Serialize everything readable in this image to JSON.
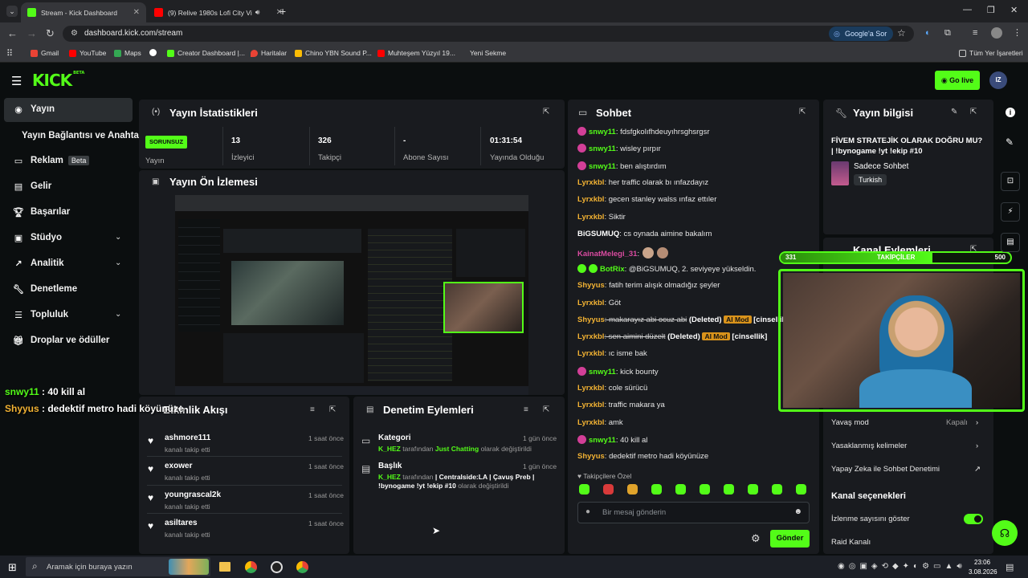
{
  "browser": {
    "tabs": [
      {
        "title": "Stream - Kick Dashboard",
        "active": true,
        "icon": "kick-icon"
      },
      {
        "title": "(9) Relive 1980s Lofi City Vi",
        "active": false,
        "icon": "youtube-icon"
      }
    ],
    "url": "dashboard.kick.com/stream",
    "google_sor": "Google'a Sor",
    "bookmarks": [
      "Gmail",
      "YouTube",
      "Maps",
      "Creator Dashboard |...",
      "Haritalar",
      "Chino YBN Sound P...",
      "Muhteşem Yüzyıl 19...",
      "Yeni Sekme"
    ],
    "all_bookmarks": "Tüm Yer İşaretleri"
  },
  "header": {
    "logo": "KICK",
    "logo_tag": "BETA",
    "go_live": "Go live",
    "avatar": "IZ"
  },
  "sidebar": {
    "items": [
      {
        "label": "Yayın",
        "icon": "broadcast-icon"
      },
      {
        "label": "Yayın Bağlantısı ve Anahtarı",
        "icon": ""
      },
      {
        "label": "Reklam",
        "badge": "Beta",
        "icon": "monitor-icon"
      },
      {
        "label": "Gelir",
        "icon": "revenue-icon"
      },
      {
        "label": "Başarılar",
        "icon": "trophy-icon"
      },
      {
        "label": "Stüdyo",
        "icon": "studio-icon"
      },
      {
        "label": "Analitik",
        "icon": "analytics-icon"
      },
      {
        "label": "Denetleme",
        "icon": "wrench-icon"
      },
      {
        "label": "Topluluk",
        "icon": "community-icon"
      },
      {
        "label": "Droplar ve ödüller",
        "icon": "gift-icon"
      }
    ]
  },
  "overlay_chat": [
    {
      "user": "snwy11",
      "text": " : 40 kill al",
      "color": "#53fc18"
    },
    {
      "user": "Shyyus",
      "text": " : dedektif metro hadi köyünüze",
      "color": "#f2b233"
    }
  ],
  "stats": {
    "title": "Yayın İstatistikleri",
    "status": "SORUNSUZ",
    "status_label": "Yayın",
    "items": [
      {
        "value": "13",
        "label": "İzleyici"
      },
      {
        "value": "326",
        "label": "Takipçi"
      },
      {
        "value": "-",
        "label": "Abone Sayısı"
      },
      {
        "value": "01:31:54",
        "label": "Yayında Olduğu"
      }
    ]
  },
  "preview": {
    "title": "Yayın Ön İzlemesi"
  },
  "activity": {
    "title": "Etkinlik Akışı",
    "items": [
      {
        "name": "ashmore111",
        "sub": "kanalı takip etti",
        "time": "1 saat önce"
      },
      {
        "name": "exower",
        "sub": "kanalı takip etti",
        "time": "1 saat önce"
      },
      {
        "name": "youngrascal2k",
        "sub": "kanalı takip etti",
        "time": "1 saat önce"
      },
      {
        "name": "asiltares",
        "sub": "kanalı takip etti",
        "time": "1 saat önce"
      }
    ]
  },
  "moderation": {
    "title": "Denetim Eylemleri",
    "items": [
      {
        "name": "Kategori",
        "who": "K_HEZ",
        "mid": " tarafından ",
        "value": "Just Chatting",
        "end": " olarak değiştirildi",
        "time": "1 gün önce"
      },
      {
        "name": "Başlık",
        "who": "K_HEZ",
        "mid": " tarafından ",
        "value": "| Centralside:LA | Çavuş Preb | !bynogame !yt !ekip #10",
        "end": " olarak değiştirildi",
        "time": "1 gün önce"
      }
    ]
  },
  "chat": {
    "title": "Sohbet",
    "messages": [
      {
        "user": "snwy11",
        "color": "#53fc18",
        "badge": true,
        "text": ": fdsfgkolıfhdeuyıhrsghsrgsr"
      },
      {
        "user": "snwy11",
        "color": "#53fc18",
        "badge": true,
        "text": ": wisley pırpır"
      },
      {
        "user": "snwy11",
        "color": "#53fc18",
        "badge": true,
        "text": ": ben alıştırdım"
      },
      {
        "user": "Lyrxkbl",
        "color": "#f2b233",
        "text": ": her traffic olarak bı ınfazdayız"
      },
      {
        "user": "Lyrxkbl",
        "color": "#f2b233",
        "text": ": gecen stanley walss ınfaz ettıler"
      },
      {
        "user": "Lyrxkbl",
        "color": "#f2b233",
        "text": ": Siktir"
      },
      {
        "user": "BiGSUMUQ",
        "color": "#ffffff",
        "text": ": cs oynada aimine bakalım"
      },
      {
        "user": "KainatMelegi_31",
        "color": "#d94ba0",
        "text": ":"
      },
      {
        "user": "BotRix",
        "color": "#53fc18",
        "text": ": @BiGSUMUQ, 2. seviyeye yükseldin."
      },
      {
        "user": "Shyyus",
        "color": "#f2b233",
        "text": ": fatih terim alışık olmadığız şeyler"
      },
      {
        "user": "Lyrxkbl",
        "color": "#f2b233",
        "text": ": Göt"
      },
      {
        "user": "Shyyus",
        "color": "#f2b233",
        "text": ": makarayız abi ocuz abi",
        "deleted": "(Deleted)",
        "mod": "AI Mod",
        "tag": "[cinsellik]"
      },
      {
        "user": "Lyrxkbl",
        "color": "#f2b233",
        "text": ": sen aimini düzelt",
        "deleted": "(Deleted)",
        "mod": "AI Mod",
        "tag": "[cinsellik]"
      },
      {
        "user": "Lyrxkbl",
        "color": "#f2b233",
        "text": ": ıc isme bak"
      },
      {
        "user": "snwy11",
        "color": "#53fc18",
        "badge": true,
        "text": ": kick bounty"
      },
      {
        "user": "Lyrxkbl",
        "color": "#f2b233",
        "text": ": cole sürücü"
      },
      {
        "user": "Lyrxkbl",
        "color": "#f2b233",
        "text": ": traffic makara ya"
      },
      {
        "user": "Lyrxkbl",
        "color": "#f2b233",
        "text": ": amk"
      },
      {
        "user": "snwy11",
        "color": "#53fc18",
        "badge": true,
        "text": ": 40 kill al"
      },
      {
        "user": "Shyyus",
        "color": "#f2b233",
        "text": ": dedektif metro hadi köyünüze"
      }
    ],
    "followers_only": "Takipçilere Özel",
    "placeholder": "Bir mesaj gönderin",
    "send": "Gönder"
  },
  "info": {
    "title": "Yayın bilgisi",
    "stream_title": "FİVEM STRATEJİK OLARAK DOĞRU MU? | !bynogame !yt !ekip #10",
    "category": "Sadece Sohbet",
    "language": "Turkish"
  },
  "channel_actions": {
    "title": "Kanal Eylemleri",
    "followers_goal": {
      "label": "TAKİPÇİLER",
      "current": "331",
      "target": "500",
      "progress": 0.66
    }
  },
  "chat_settings": {
    "slow_mode": "Yavaş mod",
    "slow_mode_value": "Kapalı",
    "banned_words": "Yasaklanmış kelimeler",
    "ai_moderation": "Yapay Zeka ile Sohbet Denetimi",
    "channel_options": "Kanal seçenekleri",
    "show_viewers": "İzlenme sayısını göster",
    "raid": "Raid Kanalı"
  },
  "taskbar": {
    "search": "Aramak için buraya yazın",
    "time": "23:06",
    "date": "3.08.2026"
  }
}
